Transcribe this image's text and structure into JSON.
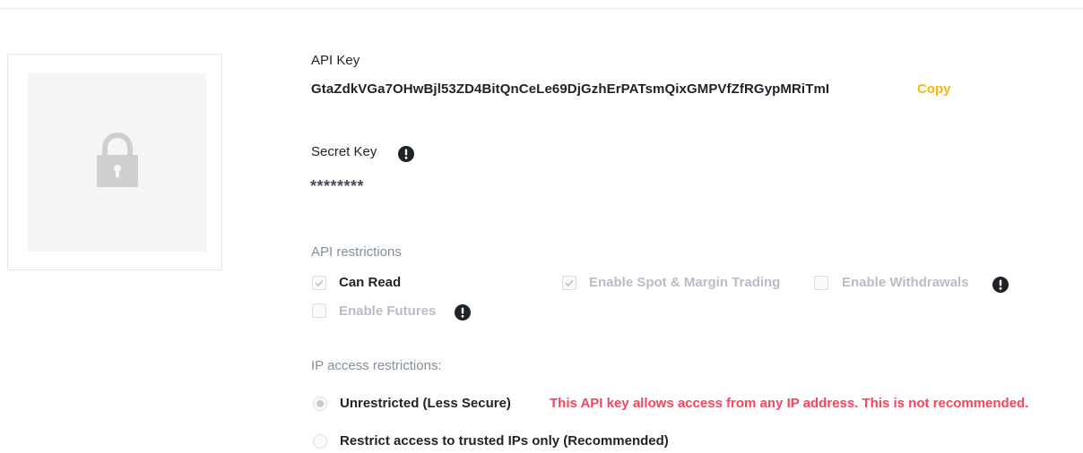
{
  "api_key": {
    "label": "API Key",
    "value": "GtaZdkVGa7OHwBjl53ZD4BitQnCeLe69DjGzhErPATsmQixGMPVfZfRGypMRiTmI",
    "copy_label": "Copy"
  },
  "secret_key": {
    "label": "Secret Key",
    "value": "********"
  },
  "api_restrictions": {
    "label": "API restrictions",
    "options": [
      {
        "label": "Can Read",
        "checked": true,
        "disabled": true
      },
      {
        "label": "Enable Spot & Margin Trading",
        "checked": true,
        "disabled": true
      },
      {
        "label": "Enable Withdrawals",
        "checked": false,
        "disabled": true
      },
      {
        "label": "Enable Futures",
        "checked": false,
        "disabled": true
      }
    ]
  },
  "ip_restrictions": {
    "label": "IP access restrictions:",
    "options": [
      {
        "label": "Unrestricted (Less Secure)",
        "selected": true
      },
      {
        "label": "Restrict access to trusted IPs only (Recommended)",
        "selected": false
      }
    ],
    "warning": "This API key allows access from any IP address. This is not recommended."
  },
  "icons": {
    "lock": "lock-icon",
    "info": "info-icon",
    "check": "check-icon"
  },
  "colors": {
    "accent": "#f0b90b",
    "warning": "#f6465d",
    "muted": "#848e9c",
    "disabled_text": "#b7bdc6"
  }
}
